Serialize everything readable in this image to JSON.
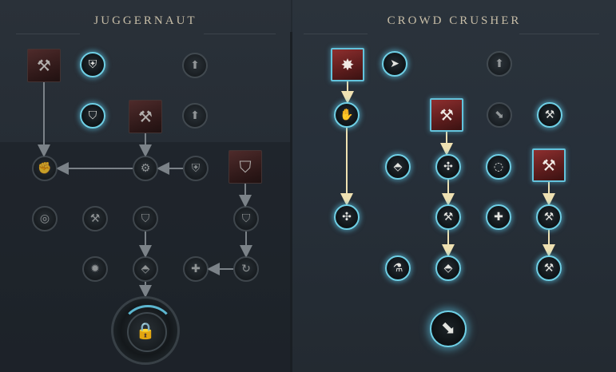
{
  "panels": [
    {
      "id": "left",
      "title": "JUGGERNAUT"
    },
    {
      "id": "right",
      "title": "CROWD CRUSHER"
    }
  ],
  "colors": {
    "background": "#232a31",
    "title": "#c7bda7",
    "active_ring": "#6fd0e6",
    "active_link": "#efe1b2",
    "inactive_link": "#7b8288",
    "ability_square": "#8e2f2f"
  },
  "nodes": [
    {
      "name": "juggernaut-ability-chained-hammer",
      "kind": "square",
      "state": "dim",
      "icon": "hammer-chain-icon",
      "glyph": "⚒"
    },
    {
      "name": "juggernaut-passive-armor",
      "kind": "circle",
      "state": "active",
      "icon": "chest-armor-icon",
      "glyph": "⛨"
    },
    {
      "name": "juggernaut-passive-bonus-1",
      "kind": "circle",
      "state": "dim",
      "icon": "upgrade-arrow-icon",
      "glyph": "⬆"
    },
    {
      "name": "juggernaut-passive-shield",
      "kind": "circle",
      "state": "active",
      "icon": "shield-icon",
      "glyph": "⛉"
    },
    {
      "name": "juggernaut-ability-slam",
      "kind": "square",
      "state": "dim",
      "icon": "hammer-slam-icon",
      "glyph": "⚒"
    },
    {
      "name": "juggernaut-passive-bonus-2",
      "kind": "circle",
      "state": "dim",
      "icon": "upgrade-arrow-icon",
      "glyph": "⬆"
    },
    {
      "name": "juggernaut-passive-fist",
      "kind": "circle",
      "state": "dim",
      "icon": "fist-icon",
      "glyph": "✊"
    },
    {
      "name": "juggernaut-passive-gear",
      "kind": "circle",
      "state": "dim",
      "icon": "gear-icon",
      "glyph": "⚙"
    },
    {
      "name": "juggernaut-passive-armor-2",
      "kind": "circle",
      "state": "dim",
      "icon": "chest-armor-icon",
      "glyph": "⛨"
    },
    {
      "name": "juggernaut-ability-shield-bash",
      "kind": "square",
      "state": "dim",
      "icon": "shield-bash-icon",
      "glyph": "⛉"
    },
    {
      "name": "juggernaut-passive-ring",
      "kind": "circle",
      "state": "dim",
      "icon": "ring-icon",
      "glyph": "◎"
    },
    {
      "name": "juggernaut-passive-hammer",
      "kind": "circle",
      "state": "dim",
      "icon": "hammer-icon",
      "glyph": "⚒"
    },
    {
      "name": "juggernaut-passive-shield-2",
      "kind": "circle",
      "state": "dim",
      "icon": "shield-icon",
      "glyph": "⛉"
    },
    {
      "name": "juggernaut-passive-shield-3",
      "kind": "circle",
      "state": "dim",
      "icon": "shield-icon",
      "glyph": "⛉"
    },
    {
      "name": "juggernaut-passive-burst",
      "kind": "circle",
      "state": "dim",
      "icon": "burst-icon",
      "glyph": "✹"
    },
    {
      "name": "juggernaut-passive-rune",
      "kind": "circle",
      "state": "dim",
      "icon": "rune-icon",
      "glyph": "⬘"
    },
    {
      "name": "juggernaut-passive-cross",
      "kind": "circle",
      "state": "dim",
      "icon": "cross-icon",
      "glyph": "✚"
    },
    {
      "name": "juggernaut-passive-cycle",
      "kind": "circle",
      "state": "dim",
      "icon": "cycle-icon",
      "glyph": "↻"
    },
    {
      "name": "juggernaut-ultimate-locked",
      "kind": "lock",
      "state": "locked",
      "icon": "lock-icon",
      "glyph": "🔒"
    },
    {
      "name": "crowd-crusher-ability-shockwave",
      "kind": "square",
      "state": "active",
      "icon": "shockwave-icon",
      "glyph": "✸"
    },
    {
      "name": "crowd-crusher-passive-charge",
      "kind": "circle",
      "state": "active",
      "icon": "charge-icon",
      "glyph": "➤"
    },
    {
      "name": "crowd-crusher-passive-bonus",
      "kind": "circle",
      "state": "dim",
      "icon": "upgrade-arrow-icon",
      "glyph": "⬆"
    },
    {
      "name": "crowd-crusher-passive-hand",
      "kind": "circle",
      "state": "active",
      "icon": "hand-icon",
      "glyph": "✋"
    },
    {
      "name": "crowd-crusher-ability-hammer-strike",
      "kind": "square",
      "state": "active",
      "icon": "hammer-strike-icon",
      "glyph": "⚒"
    },
    {
      "name": "crowd-crusher-passive-boot",
      "kind": "circle",
      "state": "dim",
      "icon": "boot-icon",
      "glyph": "⬊"
    },
    {
      "name": "crowd-crusher-passive-hammer",
      "kind": "circle",
      "state": "active",
      "icon": "hammer-icon",
      "glyph": "⚒"
    },
    {
      "name": "crowd-crusher-passive-rune",
      "kind": "circle",
      "state": "active",
      "icon": "rune-icon",
      "glyph": "⬘"
    },
    {
      "name": "crowd-crusher-passive-scatter",
      "kind": "circle",
      "state": "active",
      "icon": "scatter-icon",
      "glyph": "✣"
    },
    {
      "name": "crowd-crusher-passive-orbit",
      "kind": "circle",
      "state": "active",
      "icon": "orbit-icon",
      "glyph": "◌"
    },
    {
      "name": "crowd-crusher-ability-quake",
      "kind": "square",
      "state": "active",
      "icon": "quake-icon",
      "glyph": "⚒"
    },
    {
      "name": "crowd-crusher-passive-scatter-2",
      "kind": "circle",
      "state": "active",
      "icon": "scatter-icon",
      "glyph": "✣"
    },
    {
      "name": "crowd-crusher-passive-hammer-2",
      "kind": "circle",
      "state": "active",
      "icon": "hammer-icon",
      "glyph": "⚒"
    },
    {
      "name": "crowd-crusher-passive-cross",
      "kind": "circle",
      "state": "active",
      "icon": "cross-icon",
      "glyph": "✚"
    },
    {
      "name": "crowd-crusher-passive-hammer-3",
      "kind": "circle",
      "state": "active",
      "icon": "hammer-icon",
      "glyph": "⚒"
    },
    {
      "name": "crowd-crusher-passive-potion",
      "kind": "circle",
      "state": "active",
      "icon": "potion-icon",
      "glyph": "⚗"
    },
    {
      "name": "crowd-crusher-passive-rune-2",
      "kind": "circle",
      "state": "active",
      "icon": "rune-icon",
      "glyph": "⬘"
    },
    {
      "name": "crowd-crusher-passive-hammer-4",
      "kind": "circle",
      "state": "active",
      "icon": "hammer-icon",
      "glyph": "⚒"
    },
    {
      "name": "crowd-crusher-ultimate",
      "kind": "big",
      "state": "active",
      "icon": "boot-stomp-icon",
      "glyph": "⬊"
    }
  ],
  "links": [
    {
      "from": "juggernaut-ability-chained-hammer",
      "to": "juggernaut-passive-gear",
      "state": "dim"
    },
    {
      "from": "juggernaut-passive-gear",
      "to": "juggernaut-passive-ring",
      "state": "dim"
    },
    {
      "from": "juggernaut-ability-slam",
      "to": "juggernaut-passive-armor-2",
      "state": "dim"
    },
    {
      "from": "juggernaut-passive-armor-2",
      "to": "juggernaut-passive-shield-2",
      "state": "dim"
    },
    {
      "from": "juggernaut-passive-shield-2",
      "to": "juggernaut-passive-rune",
      "state": "dim"
    },
    {
      "from": "juggernaut-passive-rune",
      "to": "juggernaut-ultimate-locked",
      "state": "dim"
    },
    {
      "from": "juggernaut-ability-shield-bash",
      "to": "juggernaut-passive-shield-3",
      "state": "dim"
    },
    {
      "from": "juggernaut-passive-shield-3",
      "to": "juggernaut-passive-cycle",
      "state": "dim"
    },
    {
      "from": "juggernaut-passive-cycle",
      "to": "juggernaut-passive-cross",
      "state": "dim"
    },
    {
      "from": "crowd-crusher-ability-shockwave",
      "to": "crowd-crusher-passive-hand",
      "state": "active"
    },
    {
      "from": "crowd-crusher-passive-hand",
      "to": "crowd-crusher-passive-scatter-2",
      "state": "active"
    },
    {
      "from": "crowd-crusher-ability-hammer-strike",
      "to": "crowd-crusher-passive-scatter",
      "state": "active"
    },
    {
      "from": "crowd-crusher-passive-scatter",
      "to": "crowd-crusher-passive-hammer-2",
      "state": "active"
    },
    {
      "from": "crowd-crusher-passive-hammer-2",
      "to": "crowd-crusher-passive-rune-2",
      "state": "active"
    },
    {
      "from": "crowd-crusher-ability-quake",
      "to": "crowd-crusher-passive-hammer-3",
      "state": "active"
    },
    {
      "from": "crowd-crusher-passive-hammer-3",
      "to": "crowd-crusher-passive-hammer-4",
      "state": "active"
    }
  ]
}
